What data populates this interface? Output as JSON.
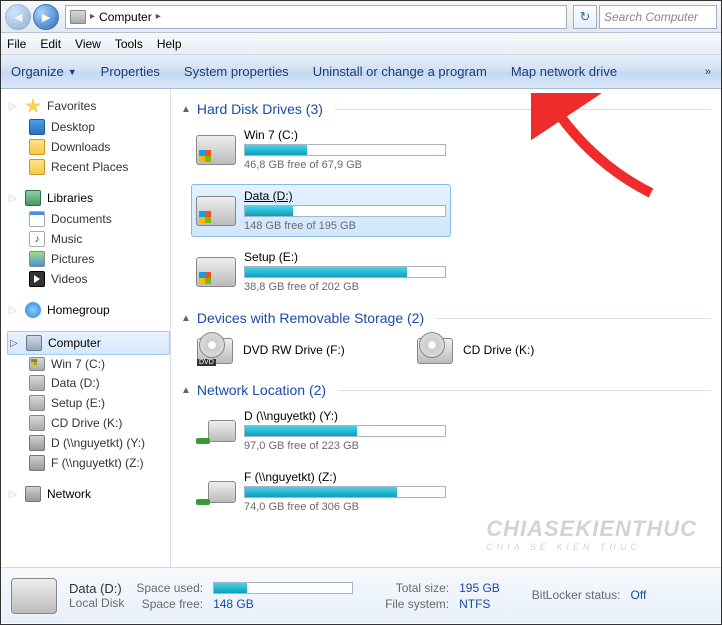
{
  "address": {
    "root": "Computer"
  },
  "search": {
    "placeholder": "Search Computer"
  },
  "menu": {
    "file": "File",
    "edit": "Edit",
    "view": "View",
    "tools": "Tools",
    "help": "Help"
  },
  "cmdbar": {
    "organize": "Organize",
    "properties": "Properties",
    "system_properties": "System properties",
    "uninstall": "Uninstall or change a program",
    "map_drive": "Map network drive",
    "more": "»"
  },
  "sidebar": {
    "favorites": "Favorites",
    "desktop": "Desktop",
    "downloads": "Downloads",
    "recent": "Recent Places",
    "libraries": "Libraries",
    "documents": "Documents",
    "music": "Music",
    "pictures": "Pictures",
    "videos": "Videos",
    "homegroup": "Homegroup",
    "computer": "Computer",
    "win7": "Win 7 (C:)",
    "data": "Data (D:)",
    "setup": "Setup (E:)",
    "cddrive": "CD Drive (K:)",
    "netY": "D (\\\\nguyetkt) (Y:)",
    "netZ": "F (\\\\nguyetkt) (Z:)",
    "network": "Network"
  },
  "groups": {
    "hdd": {
      "title": "Hard Disk Drives (3)"
    },
    "removable": {
      "title": "Devices with Removable Storage (2)"
    },
    "network": {
      "title": "Network Location (2)"
    }
  },
  "drives": {
    "c": {
      "name": "Win 7 (C:)",
      "free": "46,8 GB free of 67,9 GB",
      "pct": 31
    },
    "d": {
      "name": "Data (D:)",
      "free": "148 GB free of 195 GB",
      "pct": 24
    },
    "e": {
      "name": "Setup (E:)",
      "free": "38,8 GB free of 202 GB",
      "pct": 81
    },
    "f": {
      "name": "DVD RW Drive (F:)"
    },
    "k": {
      "name": "CD Drive (K:)"
    },
    "y": {
      "name": "D (\\\\nguyetkt) (Y:)",
      "free": "97,0 GB free of 223 GB",
      "pct": 56
    },
    "z": {
      "name": "F (\\\\nguyetkt) (Z:)",
      "free": "74,0 GB free of 306 GB",
      "pct": 76
    }
  },
  "details": {
    "name": "Data (D:)",
    "type": "Local Disk",
    "space_used_label": "Space used:",
    "space_free_label": "Space free:",
    "space_free": "148 GB",
    "total_label": "Total size:",
    "total": "195 GB",
    "fs_label": "File system:",
    "fs": "NTFS",
    "bitlocker_label": "BitLocker status:",
    "bitlocker": "Off",
    "used_pct": 24
  },
  "watermark": {
    "line1": "CHIASEKIENTHUC",
    "line2": "CHIA SE KIEN THUC"
  }
}
